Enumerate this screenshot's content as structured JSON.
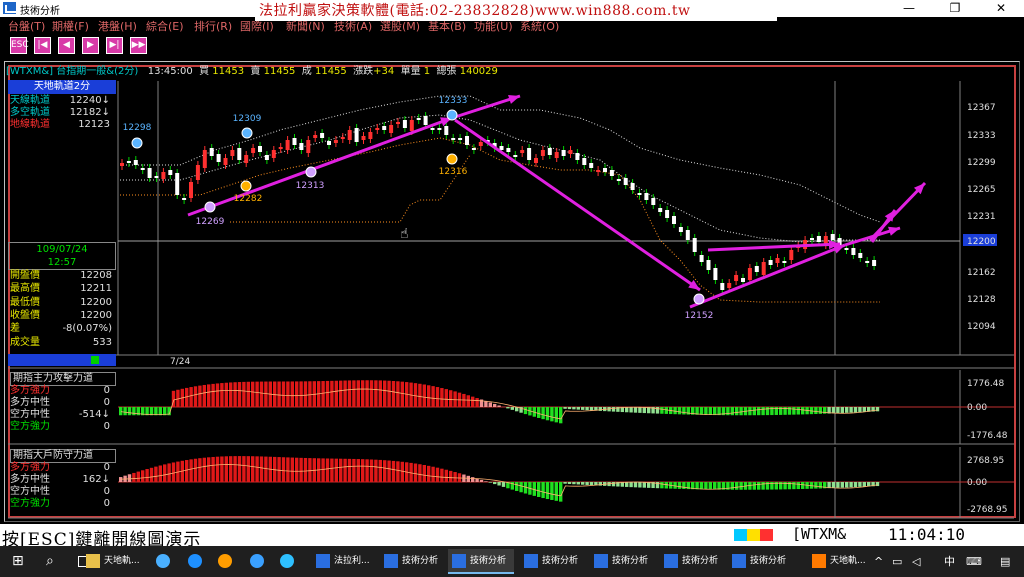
{
  "window": {
    "title": "技術分析"
  },
  "banner": "法拉利贏家決策軟體(電話:02-23832828)www.win888.com.tw",
  "menu": [
    "台盤(T)",
    "期權(F)",
    "港盤(H)",
    "綜合(E)",
    "排行(R)",
    "國際(I)",
    "新聞(N)",
    "技術(A)",
    "選股(M)",
    "基本(B)",
    "功能(U)",
    "系統(O)"
  ],
  "toolbar": [
    "ESC",
    "|◀",
    "◀",
    "▶",
    "▶|",
    "▶▶"
  ],
  "info": {
    "symbol": "[WTXM&]",
    "name": "台指期一般&(2分)",
    "time": "13:45:00",
    "bid_label": "買",
    "bid": "11453",
    "ask_label": "賣",
    "ask": "11455",
    "trade_label": "成",
    "trade": "11455",
    "change_label": "漲跌",
    "change": "+34",
    "vol_label": "單量",
    "vol": "1",
    "total_label": "總張",
    "total": "140029"
  },
  "leftpanel": {
    "title": "天地軌道2分",
    "rows": [
      {
        "label": "天線軌道",
        "value": "12240↓",
        "color": "#00c8c8"
      },
      {
        "label": "多空軌道",
        "value": "12182↓",
        "color": "#00c8c8"
      },
      {
        "label": "地線軌道",
        "value": "12123",
        "color": "#ff3030"
      }
    ],
    "date": "109/07/24",
    "time": "12:57",
    "ohlc": [
      {
        "label": "開盤價",
        "value": "12208"
      },
      {
        "label": "最高價",
        "value": "12211"
      },
      {
        "label": "最低價",
        "value": "12200"
      },
      {
        "label": "收盤價",
        "value": "12200"
      },
      {
        "label": "差",
        "value": "-8(0.07%)"
      },
      {
        "label": "成交量",
        "value": "533"
      }
    ]
  },
  "chart_data": {
    "type": "candlestick",
    "y_ticks": [
      "12367",
      "12333",
      "12299",
      "12265",
      "12231",
      "12200",
      "12162",
      "12128",
      "12094"
    ],
    "current_price": "12200",
    "x_label": "7/24",
    "annotations": [
      {
        "text": "12298",
        "color": "#5ab4ff"
      },
      {
        "text": "12309",
        "color": "#5ab4ff"
      },
      {
        "text": "12333",
        "color": "#5ab4ff"
      },
      {
        "text": "12313",
        "color": "#d0a0ff"
      },
      {
        "text": "12282",
        "color": "#ffb000"
      },
      {
        "text": "12316",
        "color": "#ffb000"
      },
      {
        "text": "12269",
        "color": "#d0a0ff"
      },
      {
        "text": "12152",
        "color": "#d0a0ff"
      }
    ]
  },
  "sub1": {
    "title": "期指主力攻擊力道",
    "labels": [
      {
        "t": "多方強力",
        "c": "#ff3030",
        "v": "0"
      },
      {
        "t": "多方中性",
        "c": "#e0e0e0",
        "v": "0"
      },
      {
        "t": "空方中性",
        "c": "#e0e0e0",
        "v": "-514↓"
      },
      {
        "t": "空方強力",
        "c": "#00e000",
        "v": "0"
      }
    ],
    "ticks": [
      "1776.48",
      "0.00",
      "-1776.48"
    ]
  },
  "sub2": {
    "title": "期指大戶防守力道",
    "labels": [
      {
        "t": "多方強力",
        "c": "#ff3030",
        "v": "0"
      },
      {
        "t": "多方中性",
        "c": "#e0e0e0",
        "v": "162↓"
      },
      {
        "t": "空方中性",
        "c": "#e0e0e0",
        "v": "0"
      },
      {
        "t": "空方強力",
        "c": "#00e000",
        "v": "0"
      }
    ],
    "ticks": [
      "2768.95",
      "0.00",
      "-2768.95"
    ]
  },
  "status": {
    "esc": "按[ESC]鍵離開線圖演示",
    "symbol": "[WTXM&",
    "clock": "11:04:10"
  },
  "taskbar": {
    "items": [
      "天地軌...",
      "法拉利...",
      "技術分析",
      "技術分析",
      "技術分析",
      "技術分析",
      "技術分析",
      "技術分析",
      "天地軌..."
    ],
    "tray": [
      "中",
      "⌨"
    ]
  }
}
